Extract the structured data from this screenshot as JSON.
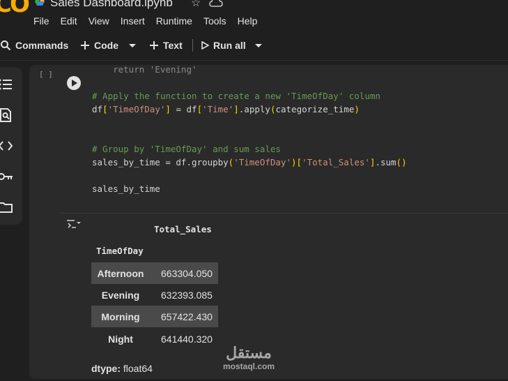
{
  "app": {
    "title": "Sales Dashboard.ipynb",
    "logo_text": "CO",
    "menu": [
      "File",
      "Edit",
      "View",
      "Insert",
      "Runtime",
      "Tools",
      "Help"
    ]
  },
  "toolbar": {
    "commands_label": "Commands",
    "code_label": "Code",
    "text_label": "Text",
    "run_all_label": "Run all"
  },
  "cell": {
    "execution_count": "[ ]",
    "code_lines": [
      {
        "parts": [
          {
            "t": "    return 'Evening'",
            "c": "faded"
          }
        ]
      },
      {
        "parts": [
          {
            "t": "",
            "c": ""
          }
        ]
      },
      {
        "parts": [
          {
            "t": "# Apply the function to create a new 'TimeOfDay' column",
            "c": "cm"
          }
        ]
      },
      {
        "parts": [
          {
            "t": "df",
            "c": ""
          },
          {
            "t": "[",
            "c": "br"
          },
          {
            "t": "'TimeOfDay'",
            "c": "st"
          },
          {
            "t": "]",
            "c": "br"
          },
          {
            "t": " = df",
            "c": ""
          },
          {
            "t": "[",
            "c": "br"
          },
          {
            "t": "'Time'",
            "c": "st"
          },
          {
            "t": "]",
            "c": "br"
          },
          {
            "t": ".apply",
            "c": ""
          },
          {
            "t": "(",
            "c": "br"
          },
          {
            "t": "categorize_time",
            "c": ""
          },
          {
            "t": ")",
            "c": "br"
          }
        ]
      },
      {
        "parts": [
          {
            "t": "",
            "c": ""
          }
        ]
      },
      {
        "parts": [
          {
            "t": "",
            "c": ""
          }
        ]
      },
      {
        "parts": [
          {
            "t": "# Group by 'TimeOfDay' and sum sales",
            "c": "cm"
          }
        ]
      },
      {
        "parts": [
          {
            "t": "sales_by_time = df.groupby",
            "c": ""
          },
          {
            "t": "(",
            "c": "br"
          },
          {
            "t": "'TimeOfDay'",
            "c": "st"
          },
          {
            "t": ")",
            "c": "br"
          },
          {
            "t": "[",
            "c": "br"
          },
          {
            "t": "'Total_Sales'",
            "c": "st"
          },
          {
            "t": "]",
            "c": "br"
          },
          {
            "t": ".sum",
            "c": ""
          },
          {
            "t": "()",
            "c": "br"
          }
        ]
      },
      {
        "parts": [
          {
            "t": "",
            "c": ""
          }
        ]
      },
      {
        "parts": [
          {
            "t": "sales_by_time",
            "c": ""
          }
        ]
      }
    ]
  },
  "output": {
    "column_header": "Total_Sales",
    "index_name": "TimeOfDay",
    "rows": [
      {
        "key": "Afternoon",
        "value": "663304.050"
      },
      {
        "key": "Evening",
        "value": "632393.085"
      },
      {
        "key": "Morning",
        "value": "657422.430"
      },
      {
        "key": "Night",
        "value": "641440.320"
      }
    ],
    "dtype_label": "dtype:",
    "dtype_value": "float64"
  },
  "watermark": {
    "arabic": "مستقل",
    "latin": "mostaql.com"
  },
  "colors": {
    "background": "#1f1f1f",
    "cell_background": "#2a2a2a",
    "comment": "#6a9955",
    "string": "#ce9178",
    "bracket": "#ffd700",
    "logo": "#f9ab00",
    "shaded_row": "#4a4a4a"
  }
}
